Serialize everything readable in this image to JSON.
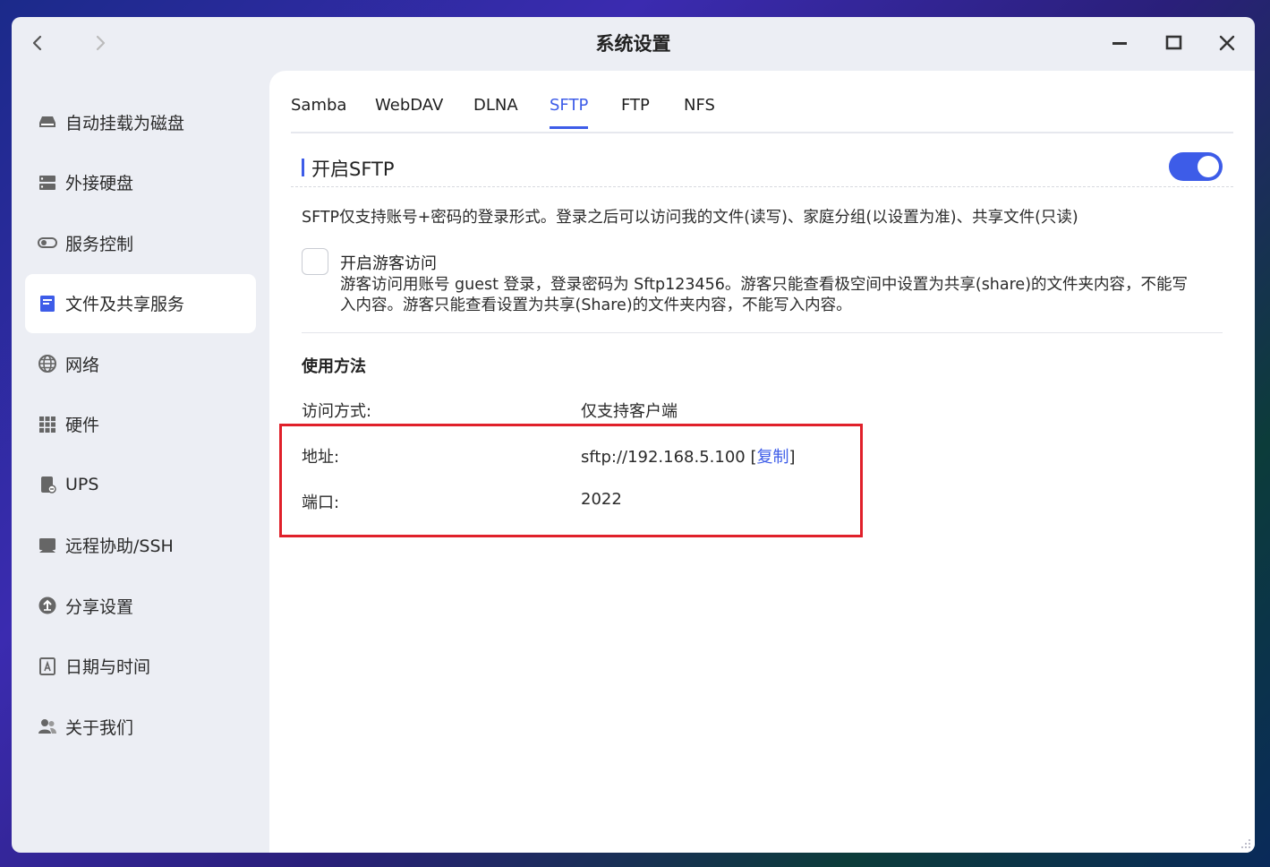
{
  "window": {
    "title": "系统设置"
  },
  "sidebar": {
    "items": [
      {
        "label": "自动挂载为磁盘",
        "icon": "drive-icon"
      },
      {
        "label": "外接硬盘",
        "icon": "server-icon"
      },
      {
        "label": "服务控制",
        "icon": "toggle-icon"
      },
      {
        "label": "文件及共享服务",
        "icon": "file-share-icon",
        "active": true
      },
      {
        "label": "网络",
        "icon": "globe-icon"
      },
      {
        "label": "硬件",
        "icon": "grid-icon"
      },
      {
        "label": "UPS",
        "icon": "ups-icon"
      },
      {
        "label": "远程协助/SSH",
        "icon": "monitor-icon"
      },
      {
        "label": "分享设置",
        "icon": "share-icon"
      },
      {
        "label": "日期与时间",
        "icon": "calendar-icon"
      },
      {
        "label": "关于我们",
        "icon": "users-icon"
      }
    ]
  },
  "tabs": [
    {
      "label": "Samba"
    },
    {
      "label": "WebDAV"
    },
    {
      "label": "DLNA"
    },
    {
      "label": "SFTP",
      "active": true
    },
    {
      "label": "FTP"
    },
    {
      "label": "NFS"
    }
  ],
  "sftp": {
    "enable_label": "开启SFTP",
    "enabled": true,
    "description": "SFTP仅支持账号+密码的登录形式。登录之后可以访问我的文件(读写)、家庭分组(以设置为准)、共享文件(只读)",
    "guest": {
      "checked": false,
      "title": "开启游客访问",
      "description": "游客访问用账号 guest 登录，登录密码为 Sftp123456。游客只能查看极空间中设置为共享(share)的文件夹内容，不能写入内容。游客只能查看设置为共享(Share)的文件夹内容，不能写入内容。"
    },
    "usage": {
      "title": "使用方法",
      "access_label": "访问方式:",
      "access_value": "仅支持客户端",
      "address_label": "地址:",
      "address_value": "sftp://192.168.5.100",
      "copy_open": " [",
      "copy_label": "复制",
      "copy_close": "]",
      "port_label": "端口:",
      "port_value": "2022"
    }
  },
  "colors": {
    "accent": "#3d5ce8",
    "highlight_box": "#e0202a"
  }
}
